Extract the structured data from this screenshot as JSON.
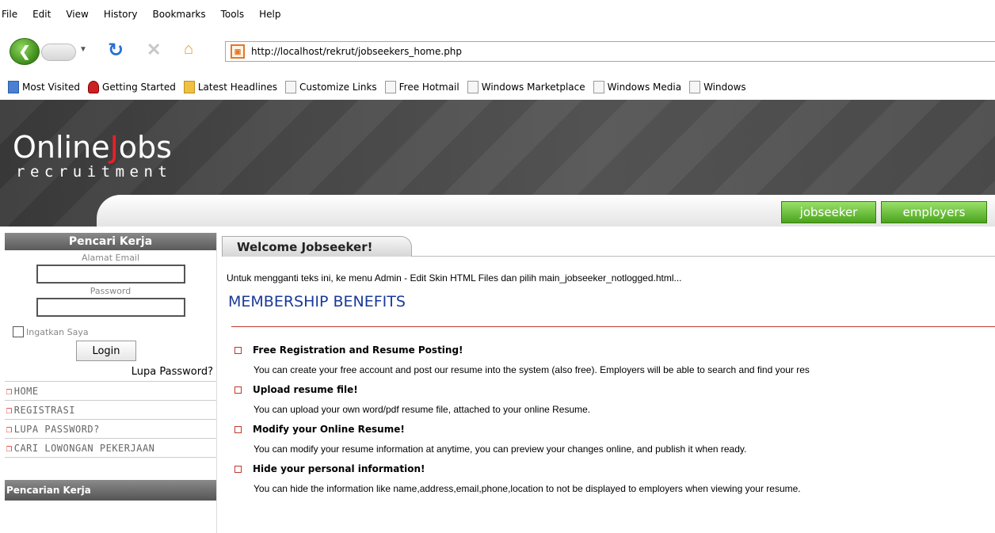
{
  "browser": {
    "menu": [
      "File",
      "Edit",
      "View",
      "History",
      "Bookmarks",
      "Tools",
      "Help"
    ],
    "url": "http://localhost/rekrut/jobseekers_home.php",
    "bookmarks": [
      "Most Visited",
      "Getting Started",
      "Latest Headlines",
      "Customize Links",
      "Free Hotmail",
      "Windows Marketplace",
      "Windows Media",
      "Windows"
    ]
  },
  "header": {
    "logo_part1": "Online",
    "logo_j": "J",
    "logo_part2": "obs",
    "logo_sub": "recruitment",
    "tab_jobseeker": "jobseeker",
    "tab_employers": "employers"
  },
  "sidebar": {
    "title": "Pencari Kerja",
    "email_label": "Alamat Email",
    "password_label": "Password",
    "remember_label": "Ingatkan Saya",
    "login_label": "Login",
    "forgot_label": "Lupa Password?",
    "menu": [
      "HOME",
      "REGISTRASI",
      "LUPA PASSWORD?",
      "CARI LOWONGAN PEKERJAAN"
    ],
    "search_title": "Pencarian Kerja"
  },
  "main": {
    "tab_title": "Welcome Jobseeker!",
    "intro": "Untuk mengganti teks ini, ke menu Admin - Edit Skin HTML Files dan pilih main_jobseeker_notlogged.html...",
    "benefits_title": "MEMBERSHIP BENEFITS",
    "benefits": [
      {
        "title": "Free Registration and Resume Posting!",
        "desc": "You can create your free account and post our resume into the system (also free). Employers will be able to search and find your res"
      },
      {
        "title": "Upload resume file!",
        "desc": "You can upload your own word/pdf resume file, attached to your online Resume."
      },
      {
        "title": "Modify your Online Resume!",
        "desc": "You can modify your resume information at anytime, you can preview your changes online, and publish it when ready."
      },
      {
        "title": "Hide your personal information!",
        "desc": "You can hide the information like name,address,email,phone,location to not be displayed to employers when viewing your resume."
      }
    ]
  },
  "colors": {
    "accent_green": "#4aa41c",
    "logo_red": "#e8202a",
    "title_blue": "#1a3a9a",
    "rule_red": "#c0392b"
  }
}
